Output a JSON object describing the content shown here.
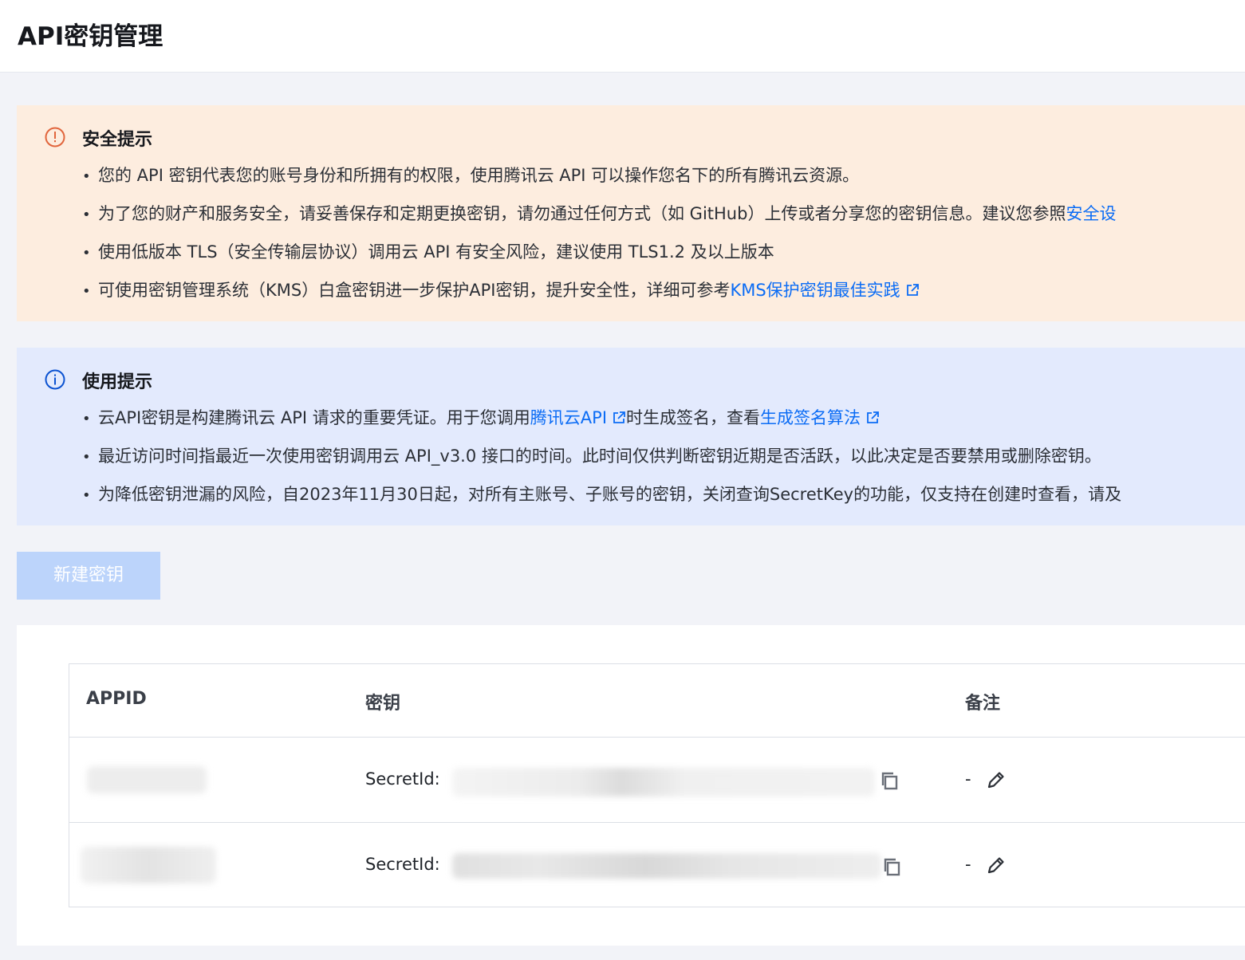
{
  "page": {
    "title": "API密钥管理"
  },
  "security_notice": {
    "heading": "安全提示",
    "icon": "alert-circle-icon",
    "items": [
      {
        "text": "您的 API 密钥代表您的账号身份和所拥有的权限，使用腾讯云 API 可以操作您名下的所有腾讯云资源。"
      },
      {
        "text": "为了您的财产和服务安全，请妥善保存和定期更换密钥，请勿通过任何方式（如 GitHub）上传或者分享您的密钥信息。建议您参照",
        "link": "安全设"
      },
      {
        "text": "使用低版本 TLS（安全传输层协议）调用云 API 有安全风险，建议使用 TLS1.2 及以上版本"
      },
      {
        "text": "可使用密钥管理系统（KMS）白盒密钥进一步保护API密钥，提升安全性，详细可参考",
        "link": "KMS保护密钥最佳实践"
      }
    ]
  },
  "usage_notice": {
    "heading": "使用提示",
    "icon": "info-circle-icon",
    "items": [
      {
        "text_before": "云API密钥是构建腾讯云 API 请求的重要凭证。用于您调用",
        "link1": "腾讯云API",
        "text_middle": "时生成签名，查看",
        "link2": "生成签名算法"
      },
      {
        "text": "最近访问时间指最近一次使用密钥调用云 API_v3.0 接口的时间。此时间仅供判断密钥近期是否活跃，以此决定是否要禁用或删除密钥。"
      },
      {
        "text": "为降低密钥泄漏的风险，自2023年11月30日起，对所有主账号、子账号的密钥，关闭查询SecretKey的功能，仅支持在创建时查看，请及"
      }
    ]
  },
  "actions": {
    "create_key_label": "新建密钥"
  },
  "table": {
    "columns": [
      "APPID",
      "密钥",
      "备注"
    ],
    "rows": [
      {
        "appid": "",
        "secret_label": "SecretId:",
        "secret_value": "",
        "remark": "-"
      },
      {
        "appid": "",
        "secret_label": "SecretId:",
        "secret_value": "",
        "remark": "-"
      }
    ]
  },
  "colors": {
    "warning_bg": "#fdeddf",
    "warning_icon": "#e1653c",
    "info_bg": "#e3eafd",
    "info_icon": "#0b52d1",
    "link": "#0b6cf5",
    "disabled_button": "#bcd4fb"
  }
}
